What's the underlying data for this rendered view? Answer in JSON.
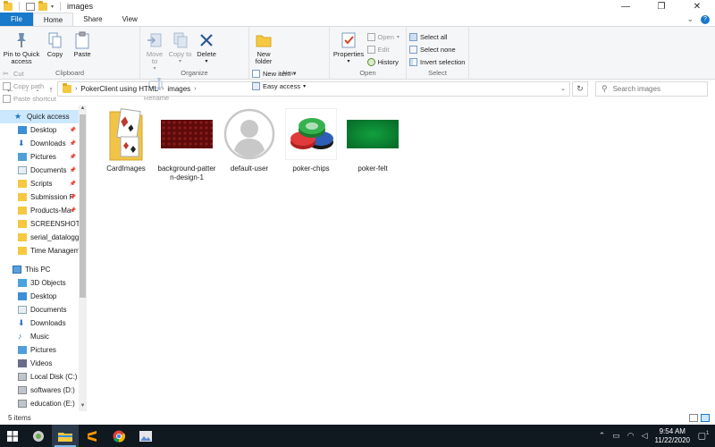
{
  "window": {
    "title": "images",
    "controls": {
      "minimize": "—",
      "maximize": "❐",
      "close": "✕"
    }
  },
  "ribbon_tabs": [
    "File",
    "Home",
    "Share",
    "View"
  ],
  "ribbon": {
    "clipboard": {
      "label": "Clipboard",
      "pin": "Pin to Quick access",
      "copy": "Copy",
      "paste": "Paste",
      "cut": "Cut",
      "copy_path": "Copy path",
      "paste_shortcut": "Paste shortcut"
    },
    "organize": {
      "label": "Organize",
      "move_to": "Move to",
      "copy_to": "Copy to",
      "delete": "Delete",
      "rename": "Rename"
    },
    "new": {
      "label": "New",
      "new_folder": "New folder",
      "new_item": "New item",
      "easy_access": "Easy access"
    },
    "open": {
      "label": "Open",
      "properties": "Properties",
      "open": "Open",
      "edit": "Edit",
      "history": "History"
    },
    "select": {
      "label": "Select",
      "select_all": "Select all",
      "select_none": "Select none",
      "invert": "Invert selection"
    }
  },
  "address": {
    "crumbs": [
      "PokerClient using HTML",
      "images"
    ],
    "search_placeholder": "Search images"
  },
  "nav": {
    "quick_access": "Quick access",
    "quick_items": [
      {
        "label": "Desktop",
        "icon": "desktop-icon"
      },
      {
        "label": "Downloads",
        "icon": "downloads-icon"
      },
      {
        "label": "Pictures",
        "icon": "pictures-icon"
      },
      {
        "label": "Documents",
        "icon": "documents-icon"
      },
      {
        "label": "Scripts",
        "icon": "folder-icon"
      },
      {
        "label": "Submission P",
        "icon": "folder-icon"
      },
      {
        "label": "Products-Ma",
        "icon": "folder-icon"
      },
      {
        "label": "SCREENSHOTS",
        "icon": "folder-icon"
      },
      {
        "label": "serial_datalogge",
        "icon": "folder-icon"
      },
      {
        "label": "Time Manageme",
        "icon": "folder-icon"
      }
    ],
    "this_pc": "This PC",
    "pc_items": [
      {
        "label": "3D Objects",
        "icon": "3d-objects-icon"
      },
      {
        "label": "Desktop",
        "icon": "desktop-icon"
      },
      {
        "label": "Documents",
        "icon": "documents-icon"
      },
      {
        "label": "Downloads",
        "icon": "downloads-icon"
      },
      {
        "label": "Music",
        "icon": "music-icon"
      },
      {
        "label": "Pictures",
        "icon": "pictures-icon"
      },
      {
        "label": "Videos",
        "icon": "videos-icon"
      },
      {
        "label": "Local Disk (C:)",
        "icon": "disk-icon"
      },
      {
        "label": "softwares (D:)",
        "icon": "disk-icon"
      },
      {
        "label": "education (E:)",
        "icon": "disk-icon"
      }
    ]
  },
  "files": [
    {
      "name": "CardImages",
      "type": "folder"
    },
    {
      "name": "background-pattern-design-1",
      "type": "image"
    },
    {
      "name": "default-user",
      "type": "image"
    },
    {
      "name": "poker-chips",
      "type": "image"
    },
    {
      "name": "poker-felt",
      "type": "image"
    }
  ],
  "status": {
    "item_count": "5 items"
  },
  "taskbar": {
    "time": "9:54 AM",
    "date": "11/22/2020",
    "notification_count": "1"
  },
  "colors": {
    "accent": "#1979ca",
    "selection": "#cce8ff",
    "felt_green": "#0a7d2c",
    "pattern_red": "#6b0f0f",
    "folder_yellow": "#f5c842"
  }
}
